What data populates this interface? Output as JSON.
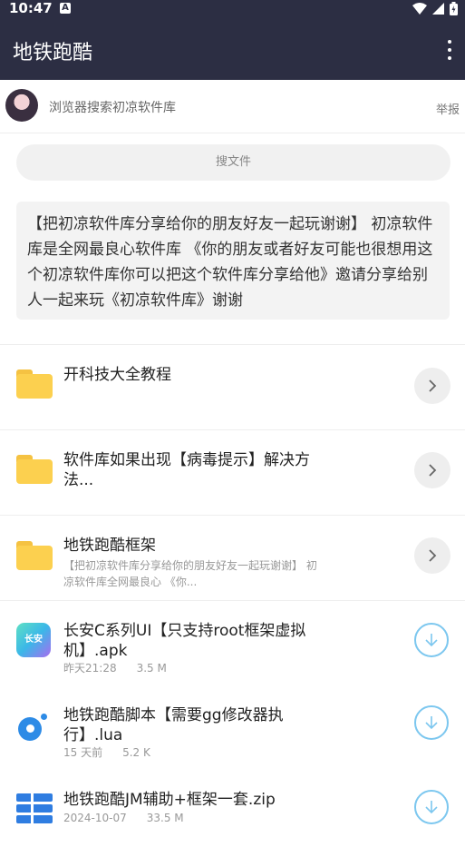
{
  "status": {
    "time": "10:47",
    "notif": "A"
  },
  "appbar": {
    "title": "地铁跑酷"
  },
  "user": {
    "name": "浏览器搜索初凉软件库",
    "report": "举报"
  },
  "search": {
    "placeholder": "搜文件"
  },
  "notice": {
    "text": "【把初凉软件库分享给你的朋友好友一起玩谢谢】 初凉软件库是全网最良心软件库 《你的朋友或者好友可能也很想用这个初凉软件库你可以把这个软件库分享给他》邀请分享给别人一起来玩《初凉软件库》谢谢"
  },
  "items": [
    {
      "type": "folder",
      "name": "开科技大全教程",
      "icon": "folder-icon"
    },
    {
      "type": "folder",
      "name": "软件库如果出现【病毒提示】解决方法...",
      "icon": "folder-icon"
    },
    {
      "type": "folder",
      "name": "地铁跑酷框架",
      "desc": "【把初凉软件库分享给你的朋友好友一起玩谢谢】 初凉软件库全网最良心 《你...",
      "icon": "folder-icon"
    },
    {
      "type": "file",
      "name": "长安C系列UI【只支持root框架虚拟机】.apk",
      "date": "昨天21:28",
      "size": "3.5 M",
      "icon_text": "长安",
      "icon": "apk-icon"
    },
    {
      "type": "file",
      "name": "地铁跑酷脚本【需要gg修改器执行】.lua",
      "date": "15 天前",
      "size": "5.2 K",
      "icon": "lua-icon"
    },
    {
      "type": "file",
      "name": "地铁跑酷JM辅助+框架一套.zip",
      "date": "2024-10-07",
      "size": "33.5 M",
      "icon": "zip-icon"
    }
  ],
  "colors": {
    "header": "#2c2e43",
    "folder": "#fcd04f",
    "download_ring": "#7cc7ef"
  }
}
